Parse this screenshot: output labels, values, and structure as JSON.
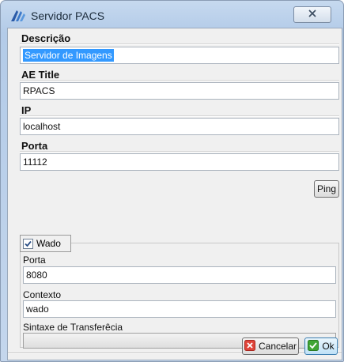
{
  "window": {
    "title": "Servidor PACS"
  },
  "fields": {
    "descricao": {
      "label": "Descrição",
      "value": "Servidor de Imagens"
    },
    "ae_title": {
      "label": "AE Title",
      "value": "RPACS"
    },
    "ip": {
      "label": "IP",
      "value": "localhost"
    },
    "porta": {
      "label": "Porta",
      "value": "11112"
    }
  },
  "ping_button": {
    "label": "Ping"
  },
  "wado": {
    "checkbox_label": "Wado",
    "checked": true,
    "porta": {
      "label": "Porta",
      "value": "8080"
    },
    "contexto": {
      "label": "Contexto",
      "value": "wado"
    },
    "sintaxe": {
      "label": "Sintaxe de Transferêcia",
      "value": ""
    }
  },
  "buttons": {
    "cancel": "Cancelar",
    "ok": "Ok"
  },
  "colors": {
    "cancel_icon": "#e0443a",
    "ok_icon": "#3fa535",
    "selection": "#3399ff"
  }
}
